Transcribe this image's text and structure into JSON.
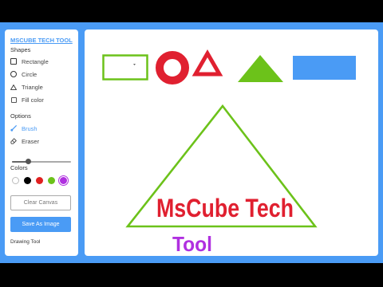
{
  "sidebar": {
    "title": "MSCUBE TECH TOOL",
    "shapes_heading": "Shapes",
    "shapes": [
      {
        "label": "Rectangle",
        "icon": "square-icon"
      },
      {
        "label": "Circle",
        "icon": "circle-icon"
      },
      {
        "label": "Triangle",
        "icon": "triangle-icon"
      }
    ],
    "fill_color_label": "Fill color",
    "options_heading": "Options",
    "tools": [
      {
        "label": "Brush",
        "icon": "brush-icon",
        "active": true
      },
      {
        "label": "Eraser",
        "icon": "eraser-icon",
        "active": false
      }
    ],
    "size_slider_value": 0.27,
    "colors_heading": "Colors",
    "colors": [
      {
        "hex": "#ffffff",
        "selected": false
      },
      {
        "hex": "#000000",
        "selected": false
      },
      {
        "hex": "#e02020",
        "selected": false
      },
      {
        "hex": "#6cc21a",
        "selected": false
      },
      {
        "hex": "#b030e0",
        "selected": true
      }
    ],
    "clear_label": "Clear Canvas",
    "save_label": "Save As Image",
    "footer": "Drawing Tool"
  },
  "canvas": {
    "text_line1": "MsCube Tech",
    "text_line2": "Tool",
    "colors": {
      "green": "#6cc21a",
      "red": "#e02030",
      "blue": "#4a9bf5",
      "purple": "#b030e0"
    }
  }
}
